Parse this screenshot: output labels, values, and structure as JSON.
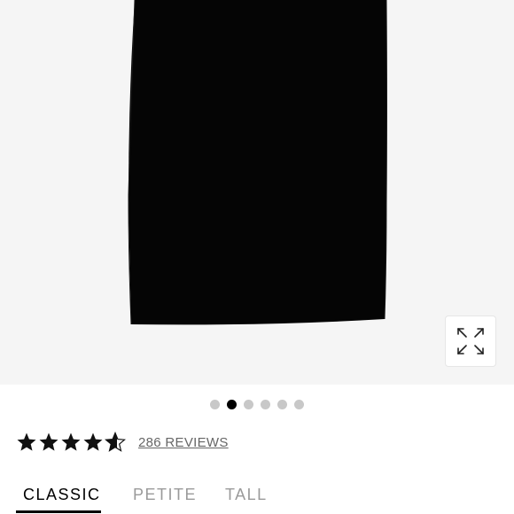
{
  "product_image": {
    "icon": "pencil-skirt-image",
    "background_color": "#f5f5f5",
    "garment_color": "#050505"
  },
  "expand_button": {
    "icon": "expand-arrows-icon"
  },
  "carousel": {
    "total_slides": 6,
    "active_index": 1
  },
  "rating": {
    "value": 4.5,
    "max": 5,
    "reviews_label": "286 REVIEWS"
  },
  "size_tabs": [
    {
      "label": "CLASSIC",
      "active": true
    },
    {
      "label": "PETITE",
      "active": false
    },
    {
      "label": "TALL",
      "active": false
    }
  ]
}
